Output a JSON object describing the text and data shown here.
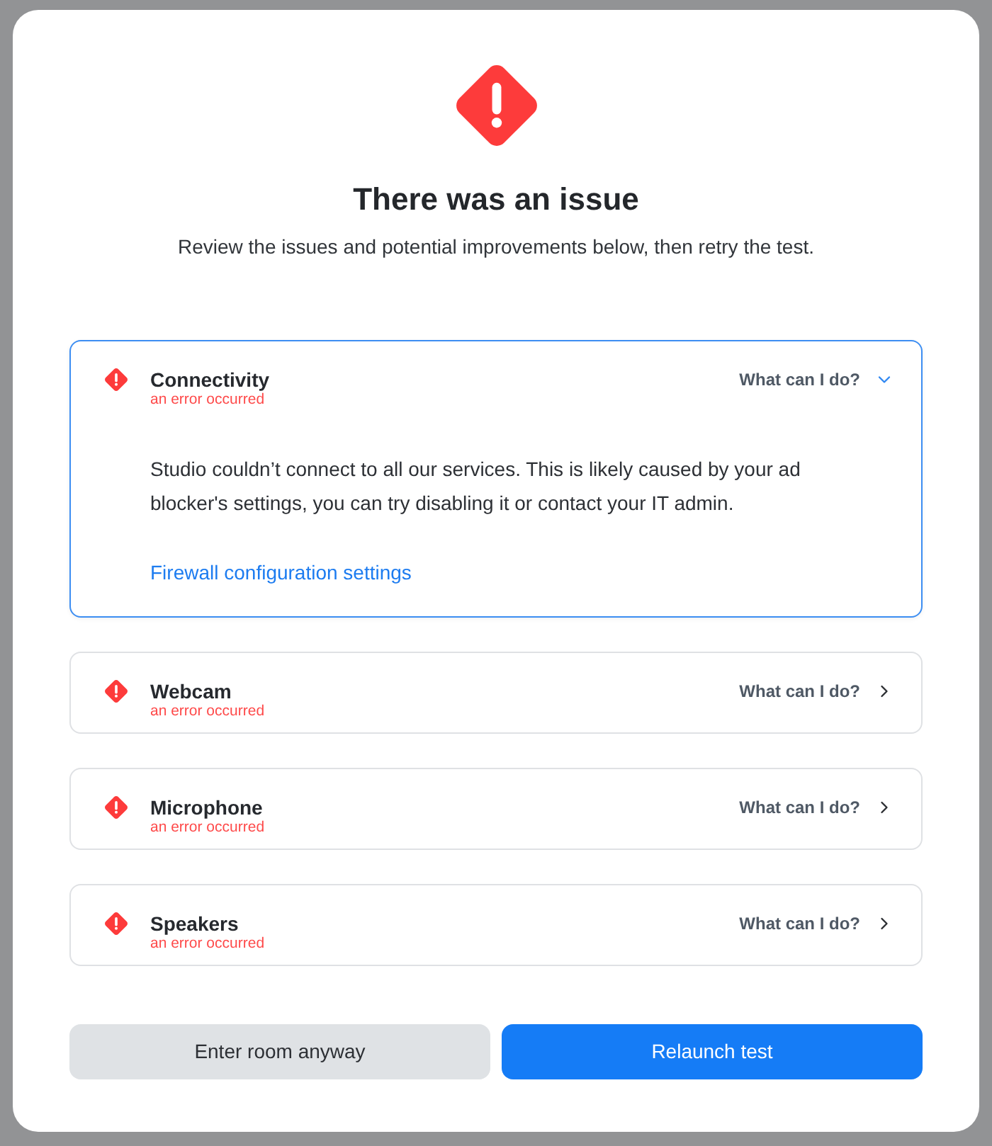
{
  "dialog": {
    "title": "There was an issue",
    "subtitle": "Review the issues and potential improvements below, then retry the test."
  },
  "issues": [
    {
      "name": "Connectivity",
      "status": "an error occurred",
      "action": "What can I do?",
      "expanded": true,
      "description": "Studio couldn’t connect to all our services. This is likely caused by your ad blocker's settings, you can try disabling it or contact your IT admin.",
      "link": "Firewall configuration settings"
    },
    {
      "name": "Webcam",
      "status": "an error occurred",
      "action": "What can I do?",
      "expanded": false
    },
    {
      "name": "Microphone",
      "status": "an error occurred",
      "action": "What can I do?",
      "expanded": false
    },
    {
      "name": "Speakers",
      "status": "an error occurred",
      "action": "What can I do?",
      "expanded": false
    }
  ],
  "buttons": [
    {
      "label": "Enter room anyway",
      "kind": "secondary"
    },
    {
      "label": "Relaunch test",
      "kind": "primary"
    }
  ]
}
